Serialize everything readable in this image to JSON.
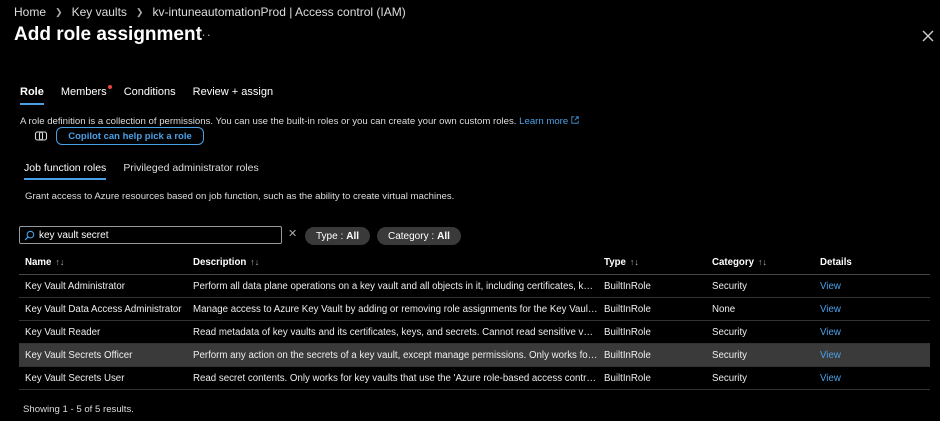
{
  "breadcrumb": [
    "Home",
    "Key vaults",
    "kv-intuneautomationProd | Access control (IAM)"
  ],
  "title": "Add role assignment",
  "more_label": "···",
  "tabs": [
    {
      "label": "Role",
      "active": true
    },
    {
      "label": "Members",
      "active": false
    },
    {
      "label": "Conditions",
      "active": false
    },
    {
      "label": "Review + assign",
      "active": false
    }
  ],
  "role_description": "A role definition is a collection of permissions. You can use the built-in roles or you can create your own custom roles.",
  "learn_more": "Learn more",
  "copilot_button": "Copilot can help pick a role",
  "subtabs": [
    {
      "label": "Job function roles",
      "active": true
    },
    {
      "label": "Privileged administrator roles",
      "active": false
    }
  ],
  "subtab_description": "Grant access to Azure resources based on job function, such as the ability to create virtual machines.",
  "search": {
    "value": "key vault secret"
  },
  "filters": {
    "type_label": "Type :",
    "type_value": "All",
    "category_label": "Category :",
    "category_value": "All"
  },
  "columns": [
    "Name",
    "Description",
    "Type",
    "Category",
    "Details"
  ],
  "rows": [
    {
      "name": "Key Vault Administrator",
      "description": "Perform all data plane operations on a key vault and all objects in it, including certificates, keys,...",
      "type": "BuiltInRole",
      "category": "Security",
      "details": "View"
    },
    {
      "name": "Key Vault Data Access Administrator",
      "description": "Manage access to Azure Key Vault by adding or removing role assignments for the Key Vault A...",
      "type": "BuiltInRole",
      "category": "None",
      "details": "View"
    },
    {
      "name": "Key Vault Reader",
      "description": "Read metadata of key vaults and its certificates, keys, and secrets. Cannot read sensitive values ...",
      "type": "BuiltInRole",
      "category": "Security",
      "details": "View"
    },
    {
      "name": "Key Vault Secrets Officer",
      "description": "Perform any action on the secrets of a key vault, except manage permissions. Only works for ke...",
      "type": "BuiltInRole",
      "category": "Security",
      "details": "View"
    },
    {
      "name": "Key Vault Secrets User",
      "description": "Read secret contents. Only works for key vaults that use the 'Azure role-based access control' p...",
      "type": "BuiltInRole",
      "category": "Security",
      "details": "View"
    }
  ],
  "footer": "Showing 1 - 5 of 5 results.",
  "colors": {
    "accent": "#4aa0e6",
    "notification_dot": "#e8463b"
  }
}
